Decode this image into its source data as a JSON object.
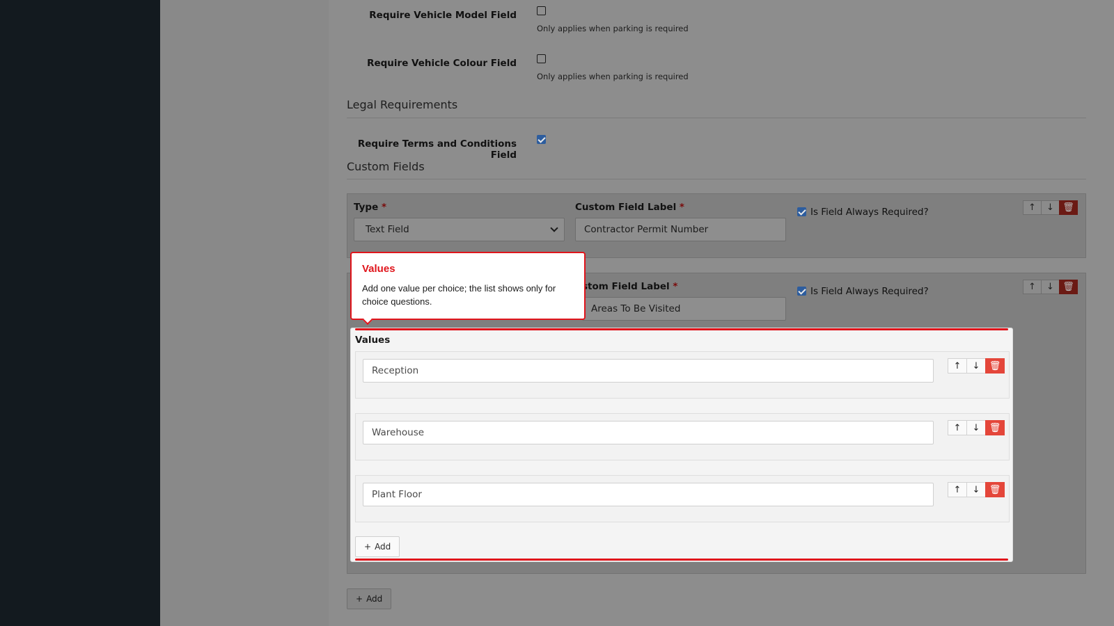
{
  "settings": {
    "vehicle_model": {
      "label": "Require Vehicle Model Field",
      "hint": "Only applies when parking is required",
      "checked": false
    },
    "vehicle_colour": {
      "label": "Require Vehicle Colour Field",
      "hint": "Only applies when parking is required",
      "checked": false
    }
  },
  "legal": {
    "section_title": "Legal Requirements",
    "terms_label": "Require Terms and Conditions Field",
    "terms_checked": true
  },
  "custom_fields": {
    "section_title": "Custom Fields",
    "type_label": "Type",
    "label_label": "Custom Field Label",
    "required_mark": "*",
    "always_required_label": "Is Field Always Required?",
    "field1": {
      "type": "Text Field",
      "label": "Contractor Permit Number",
      "always_required": true
    },
    "field2": {
      "label_partial": "stom Field Label",
      "label_value_partial": "Areas To Be Visited",
      "always_required": true
    },
    "add_label": "Add"
  },
  "values_panel": {
    "title": "Values",
    "items": [
      "Reception",
      "Warehouse",
      "Plant Floor"
    ],
    "add_label": "Add"
  },
  "tooltip": {
    "title": "Values",
    "body": "Add one value per choice; the list shows only for choice questions."
  },
  "icons": {
    "up": "arrow-up-icon",
    "down": "arrow-down-icon",
    "delete": "trash-icon",
    "plus": "plus-icon"
  },
  "colors": {
    "accent_red": "#e0141b",
    "danger": "#e4463a",
    "checkbox_blue": "#2d5d9e",
    "sidebar": "#131a1f"
  }
}
